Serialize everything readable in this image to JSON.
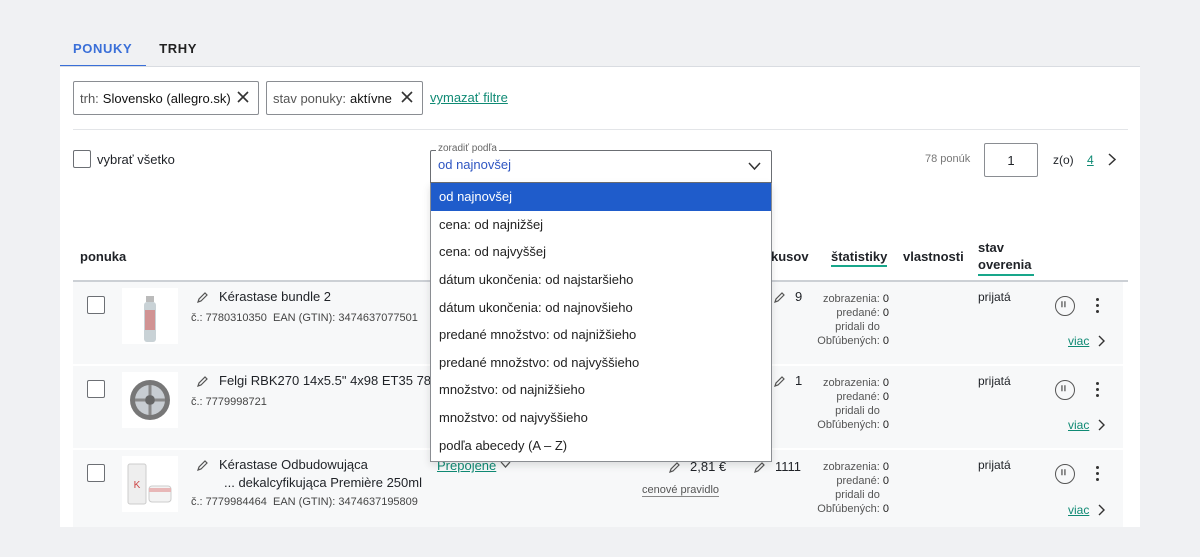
{
  "tabs": [
    {
      "label": "PONUKY",
      "active": true
    },
    {
      "label": "TRHY",
      "active": false
    }
  ],
  "filters": {
    "chips": [
      {
        "key": "trh:",
        "value": "Slovensko (allegro.sk)"
      },
      {
        "key": "stav ponuky:",
        "value": "aktívne"
      }
    ],
    "clear_label": "vymazať filtre"
  },
  "toolbar": {
    "select_all_label": "vybrať všetko",
    "sort": {
      "legend": "zoradiť podľa",
      "value": "od najnovšej",
      "options": [
        "od najnovšej",
        "cena: od najnižšej",
        "cena: od najvyššej",
        "dátum ukončenia: od najstaršieho",
        "dátum ukončenia: od najnovšieho",
        "predané množstvo: od najnižšieho",
        "predané množstvo: od najvyššieho",
        "množstvo: od najnižšieho",
        "množstvo: od najvyššieho",
        "podľa abecedy (A – Z)"
      ]
    },
    "count_label": "78 ponúk",
    "page": "1",
    "of_label": "z(o)",
    "total_pages": "4"
  },
  "columns": {
    "offer": "ponuka",
    "pieces": "kusov",
    "stats": "štatistiky",
    "props": "vlastnosti",
    "verify": "stav overenia"
  },
  "stat_labels": {
    "views": "zobrazenia:",
    "sold": "predané:",
    "fav": "pridali do Obľúbených:"
  },
  "more_label": "viac",
  "rows": [
    {
      "title": "Kérastase bundle 2",
      "title2": "",
      "id": "č.: 7780310350",
      "ean": "EAN (GTIN): 3474637077501",
      "qty": "9",
      "views": "0",
      "sold": "0",
      "fav": "0",
      "status": "prijatá",
      "linked": "",
      "price": "",
      "price_rule": ""
    },
    {
      "title": "Felgi RBK270 14x5.5\" 4x98 ET35 78",
      "title2": "",
      "id": "č.: 7779998721",
      "ean": "",
      "qty": "1",
      "views": "0",
      "sold": "0",
      "fav": "0",
      "status": "prijatá",
      "linked": "",
      "price": "",
      "price_rule": ""
    },
    {
      "title": "Kérastase Odbudowująca",
      "title2": "... dekalcyfikująca Première 250ml",
      "id": "č.: 7779984464",
      "ean": "EAN (GTIN): 3474637195809",
      "qty": "1111",
      "views": "0",
      "sold": "0",
      "fav": "0",
      "status": "prijatá",
      "linked": "Prepojené",
      "price": "2,81 €",
      "price_rule": "cenové pravidlo"
    }
  ],
  "colors": {
    "accent": "#3a6fd8",
    "link": "#0f8a74",
    "selected": "#1f5ccb"
  }
}
